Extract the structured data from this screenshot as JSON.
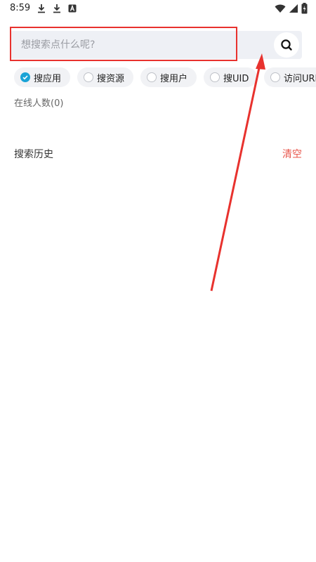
{
  "status_bar": {
    "time": "8:59",
    "left_icons": [
      "download-icon",
      "download-icon",
      "app-notification-icon"
    ],
    "right_icons": [
      "wifi-icon",
      "signal-icon",
      "battery-icon"
    ]
  },
  "search": {
    "placeholder": "想搜索点什么呢?",
    "value": "",
    "button_icon": "search-icon"
  },
  "filters": [
    {
      "label": "搜应用",
      "selected": true
    },
    {
      "label": "搜资源",
      "selected": false
    },
    {
      "label": "搜用户",
      "selected": false
    },
    {
      "label": "搜UID",
      "selected": false
    },
    {
      "label": "访问URL",
      "selected": false
    }
  ],
  "online": {
    "text": "在线人数(0)"
  },
  "history": {
    "title": "搜索历史",
    "clear_label": "清空"
  },
  "colors": {
    "accent": "#1aa3d6",
    "annotation": "#e8322e",
    "clear": "#e8544a"
  }
}
